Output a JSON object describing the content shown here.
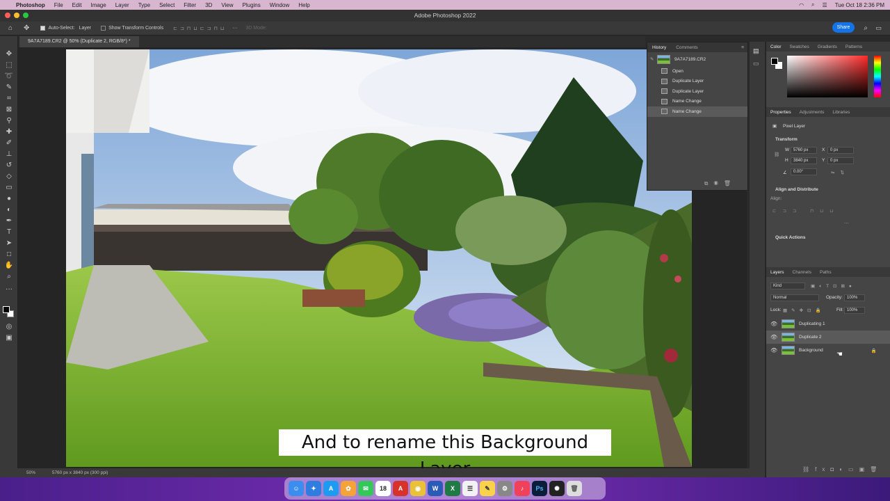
{
  "menubar": {
    "app": "Photoshop",
    "items": [
      "File",
      "Edit",
      "Image",
      "Layer",
      "Type",
      "Select",
      "Filter",
      "3D",
      "View",
      "Plugins",
      "Window",
      "Help"
    ],
    "clock": "Tue Oct 18  2:36 PM"
  },
  "window": {
    "title": "Adobe Photoshop 2022"
  },
  "options": {
    "auto_select_label": "Auto-Select:",
    "auto_select_value": "Layer",
    "transform_label": "Show Transform Controls",
    "mode_3d": "3D Mode:",
    "share": "Share"
  },
  "document": {
    "tab": "9A7A7189.CR2 @ 50% (Duplicate 2, RGB/8*) *"
  },
  "history": {
    "tabs": [
      "History",
      "Comments"
    ],
    "snapshot": "9A7A7189.CR2",
    "items": [
      "Open",
      "Duplicate Layer",
      "Duplicate Layer",
      "Name Change",
      "Name Change"
    ]
  },
  "color_panel": {
    "tabs": [
      "Color",
      "Swatches",
      "Gradients",
      "Patterns"
    ]
  },
  "properties": {
    "tabs": [
      "Properties",
      "Adjustments",
      "Libraries"
    ],
    "kind": "Pixel Layer",
    "transform": "Transform",
    "w": "5760 px",
    "h": "3840 px",
    "x": "0 px",
    "y": "0 px",
    "angle": "0.00°",
    "align": "Align and Distribute",
    "align_label": "Align:",
    "quick": "Quick Actions",
    "w_label": "W",
    "h_label": "H",
    "x_label": "X",
    "y_label": "Y"
  },
  "layers_panel": {
    "tabs": [
      "Layers",
      "Channels",
      "Paths"
    ],
    "filter": "Kind",
    "blend": "Normal",
    "opacity_label": "Opacity:",
    "opacity": "100%",
    "lock_label": "Lock:",
    "fill_label": "Fill:",
    "fill": "100%",
    "layers": [
      "Duplicating 1",
      "Duplicate 2",
      "Background"
    ]
  },
  "status": {
    "zoom": "50%",
    "dims": "5760 px x 3840 px (300 ppi)"
  },
  "caption": "And to rename this Background Layer",
  "dock": {
    "calendar_day": "18"
  }
}
